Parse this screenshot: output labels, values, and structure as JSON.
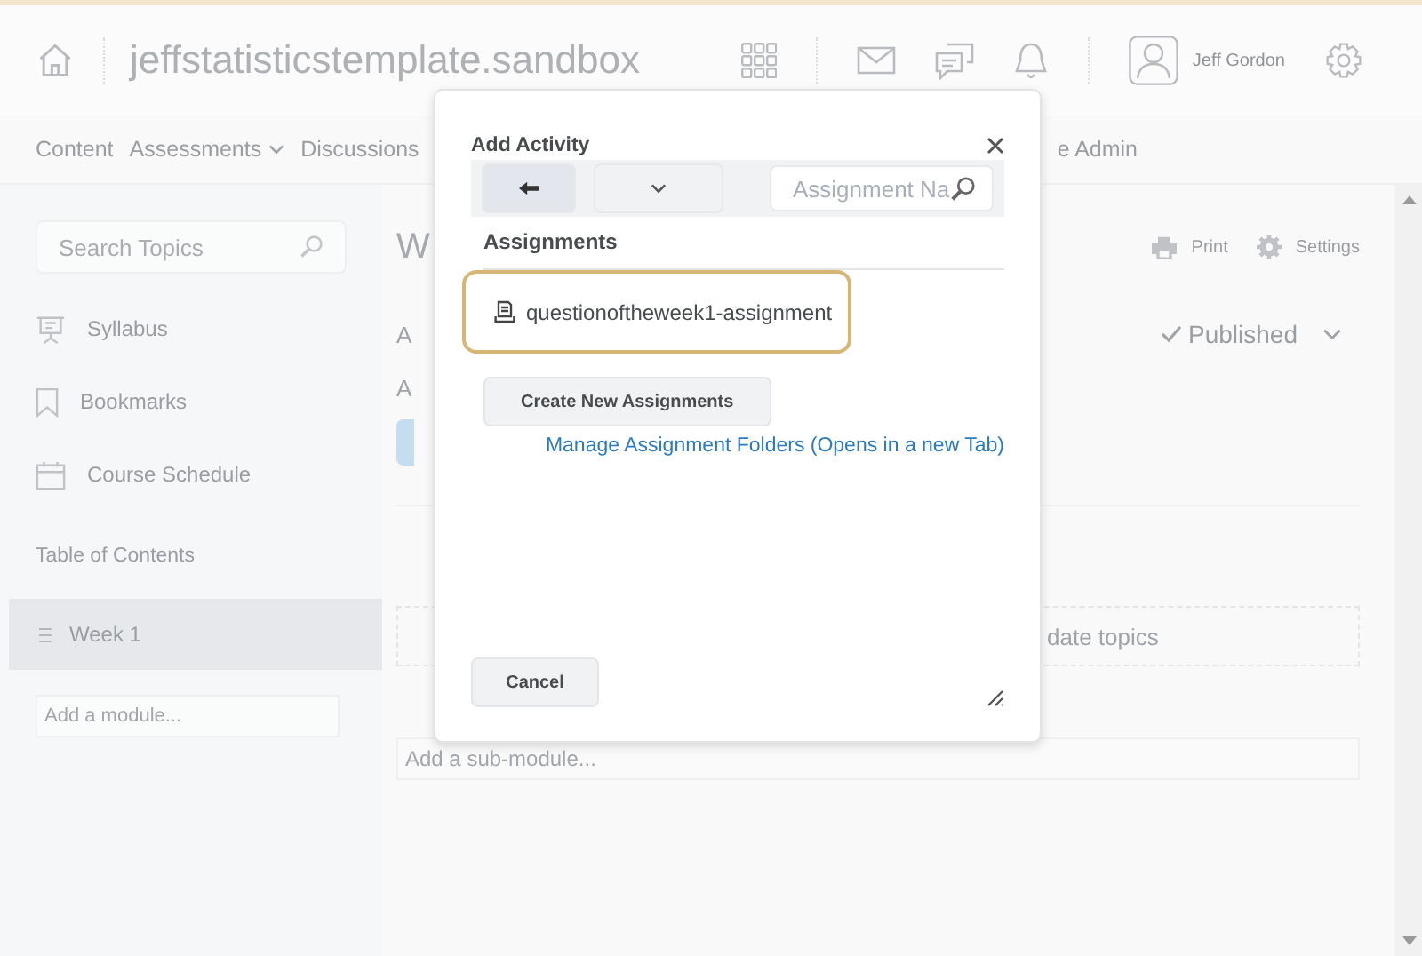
{
  "header": {
    "site_title": "jeffstatisticstemplate.sandbox",
    "user_name": "Jeff Gordon"
  },
  "nav": {
    "items": [
      {
        "label": "Content",
        "has_menu": false
      },
      {
        "label": "Assessments",
        "has_menu": true
      },
      {
        "label": "Discussions",
        "has_menu": false
      }
    ],
    "trailing_fragment": "e Admin"
  },
  "sidebar": {
    "search": {
      "placeholder": "Search Topics"
    },
    "links": [
      {
        "label": "Syllabus",
        "kind": "syllabus"
      },
      {
        "label": "Bookmarks",
        "kind": "bookmark"
      },
      {
        "label": "Course Schedule",
        "kind": "calendar"
      }
    ],
    "toc_heading": "Table of Contents",
    "modules": [
      {
        "label": "Week 1",
        "selected": true
      }
    ],
    "add_module": {
      "placeholder": "Add a module..."
    }
  },
  "main": {
    "title_fragment": "W",
    "actions": [
      {
        "label": "Print",
        "kind": "print"
      },
      {
        "label": "Settings",
        "kind": "settings"
      }
    ],
    "line_fragments": [
      "A",
      "A"
    ],
    "status": "Published",
    "drop_zone_fragment": "date topics",
    "sub_module": {
      "placeholder": "Add a sub-module..."
    }
  },
  "dialog": {
    "title": "Add Activity",
    "search": {
      "placeholder": "Assignment Na"
    },
    "section_heading": "Assignments",
    "items": [
      {
        "label": "questionoftheweek1-assignment",
        "selected": true
      }
    ],
    "create_button": "Create New Assignments",
    "manage_link": "Manage Assignment Folders (Opens in a new Tab)",
    "cancel_button": "Cancel"
  }
}
